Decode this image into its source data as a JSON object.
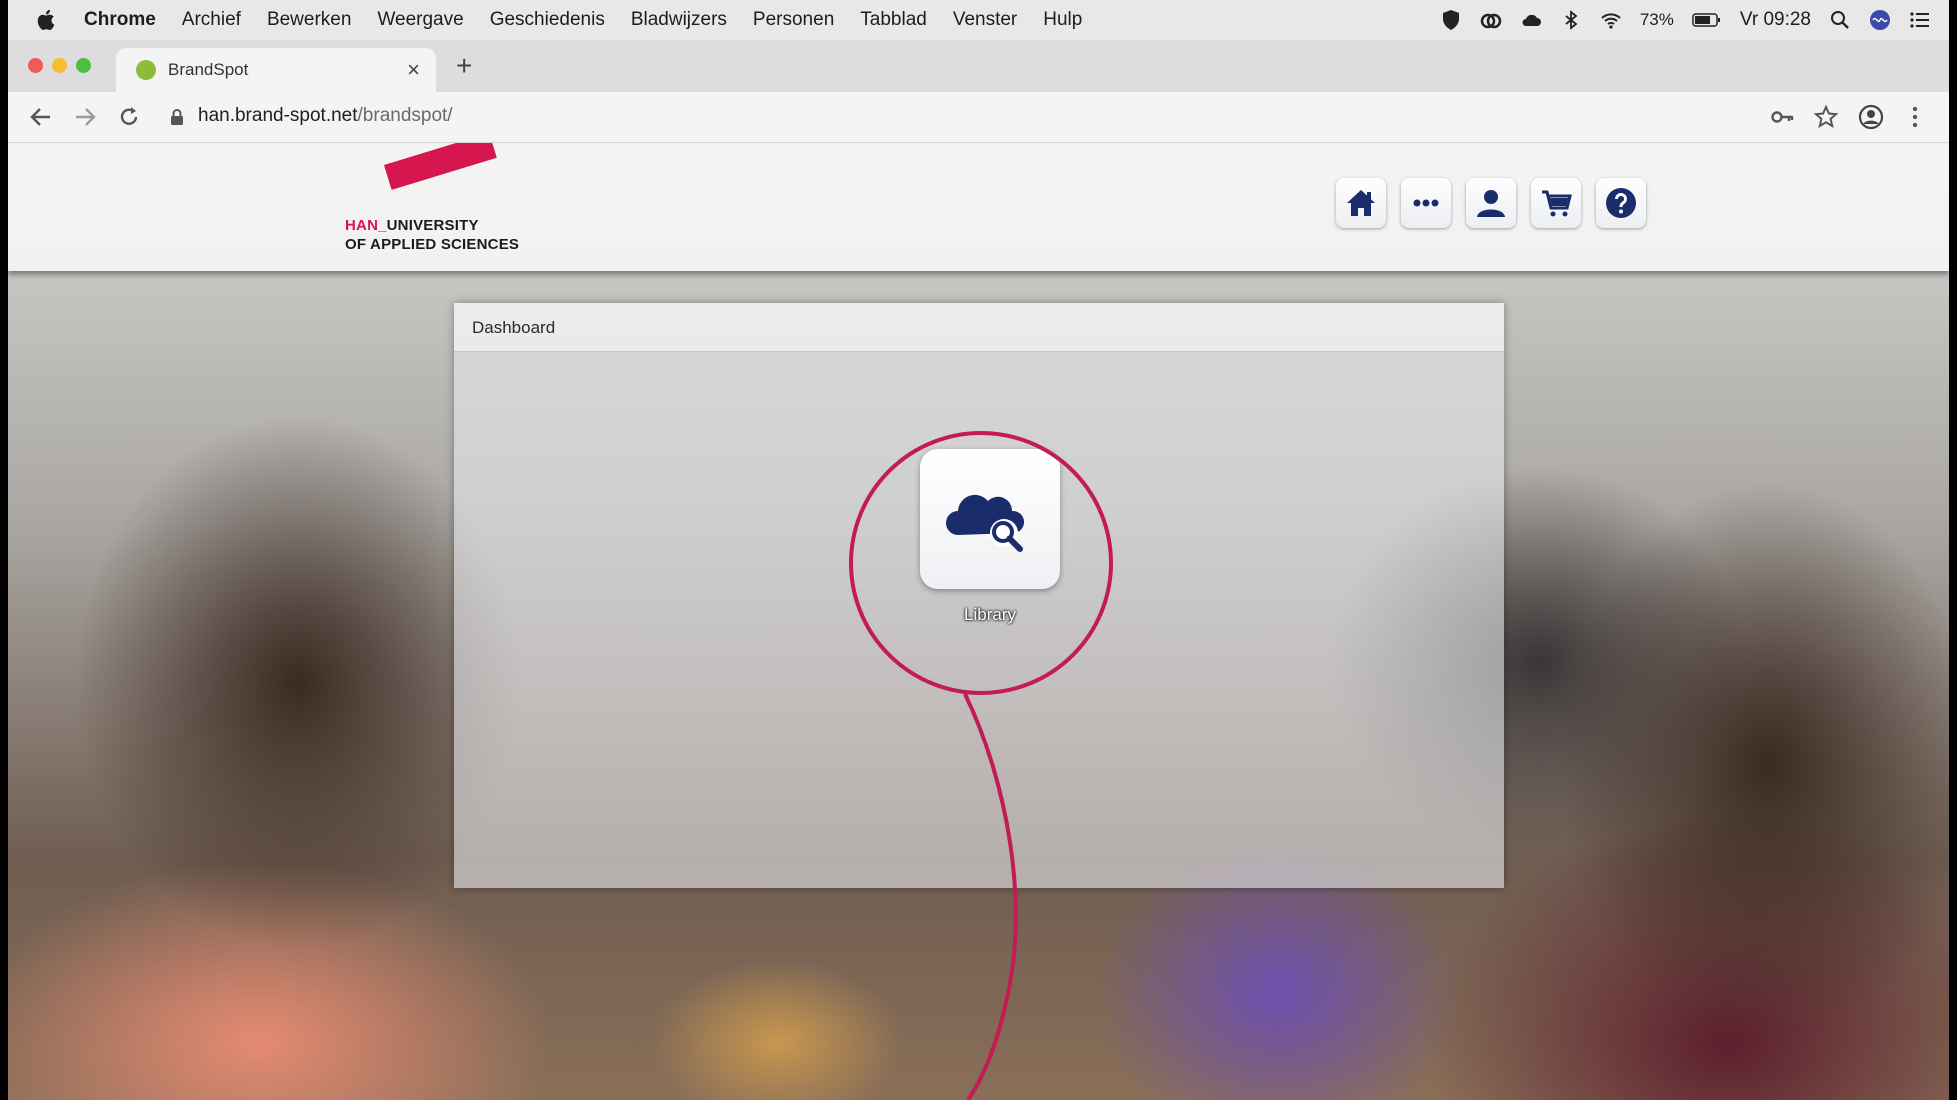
{
  "menubar": {
    "app_name": "Chrome",
    "items": [
      "Archief",
      "Bewerken",
      "Weergave",
      "Geschiedenis",
      "Bladwijzers",
      "Personen",
      "Tabblad",
      "Venster",
      "Hulp"
    ],
    "battery": "73%",
    "clock": "Vr 09:28"
  },
  "browser": {
    "tab_title": "BrandSpot",
    "tab_close": "×",
    "new_tab": "+",
    "url_host": "han.brand-spot.net",
    "url_path": "/brandspot/"
  },
  "site": {
    "logo_prefix": "HAN_",
    "logo_line1": "UNIVERSITY",
    "logo_line2": "OF APPLIED SCIENCES",
    "brand_color": "#d6174f",
    "icon_color": "#1a2c6b",
    "header_buttons": [
      "home-icon",
      "more-icon",
      "user-icon",
      "cart-icon",
      "help-icon"
    ]
  },
  "dashboard": {
    "title": "Dashboard",
    "tiles": [
      {
        "label": "Library",
        "icon": "cloud-search-icon"
      }
    ]
  },
  "annotation": {
    "color": "#c21b55"
  }
}
